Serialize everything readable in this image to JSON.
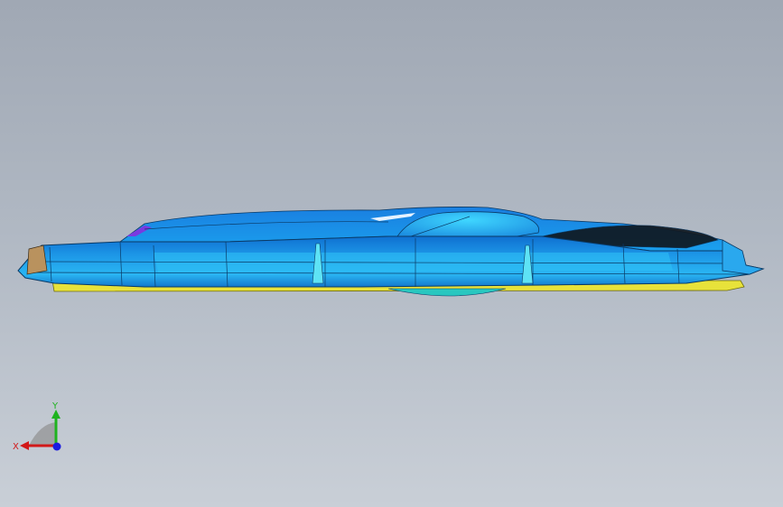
{
  "viewport": {
    "background_top": "#a0a8b4",
    "background_bottom": "#c9cfd7"
  },
  "model": {
    "body_color": "#1c95e6",
    "highlight_color": "#35d2ff",
    "edge_color": "#0a3a66",
    "base_color": "#e8e23a",
    "trim_color": "#b9925e",
    "dark_grille_color": "#101820"
  },
  "triad": {
    "x_label": "X",
    "y_label": "Y",
    "x_color": "#d21818",
    "y_color": "#1fb31f",
    "z_color": "#1a1ae0"
  }
}
